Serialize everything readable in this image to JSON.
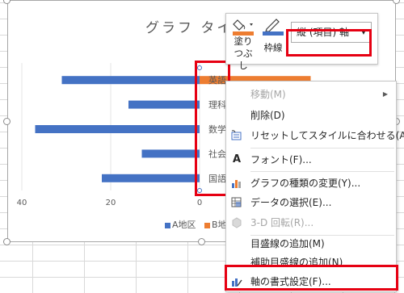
{
  "chart": {
    "title": "グラフ タイ",
    "x_ticks": [
      "40",
      "20",
      "0"
    ],
    "legend": [
      {
        "label": "A地区",
        "color": "#4472c4"
      },
      {
        "label": "B地",
        "color": "#ed7d31"
      }
    ]
  },
  "chart_data": {
    "type": "bar",
    "orientation": "horizontal",
    "title": "グラフ タイ",
    "categories": [
      "英語",
      "理科",
      "数学",
      "社会",
      "国語"
    ],
    "series": [
      {
        "name": "A地区",
        "color": "#4472c4",
        "values": [
          -31,
          -16,
          -37,
          -13,
          -22
        ]
      },
      {
        "name": "B地",
        "color": "#ed7d31",
        "values": [
          25,
          0,
          0,
          0,
          0
        ]
      }
    ],
    "xlim": [
      -40,
      10
    ]
  },
  "mini_toolbar": {
    "fill_label": "塗りつぶし",
    "outline_label": "枠線",
    "element_select_value": "縦 (項目) 軸",
    "fill_color": "#ed7d31",
    "outline_color": "#4472c4"
  },
  "context_menu": {
    "items": [
      {
        "label": "移動(M)",
        "disabled": true,
        "submenu": true,
        "icon": ""
      },
      {
        "label": "削除(D)",
        "disabled": false,
        "icon": ""
      },
      {
        "label": "リセットしてスタイルに合わせる(A)",
        "disabled": false,
        "icon": "reset-style-icon"
      },
      {
        "label": "フォント(F)...",
        "disabled": false,
        "icon": "font-icon"
      },
      {
        "label": "グラフの種類の変更(Y)...",
        "disabled": false,
        "icon": "chart-type-icon"
      },
      {
        "label": "データの選択(E)...",
        "disabled": false,
        "icon": "select-data-icon"
      },
      {
        "label": "3-D 回転(R)...",
        "disabled": true,
        "icon": "3d-rotation-icon"
      },
      {
        "label": "目盛線の追加(M)",
        "disabled": false,
        "icon": ""
      },
      {
        "label": "補助目盛線の追加(N)",
        "disabled": false,
        "icon": ""
      },
      {
        "label": "軸の書式設定(F)...",
        "disabled": false,
        "icon": "format-axis-icon"
      }
    ]
  },
  "colors": {
    "highlight_red": "#e60012",
    "series_a": "#4472c4",
    "series_b": "#ed7d31"
  }
}
